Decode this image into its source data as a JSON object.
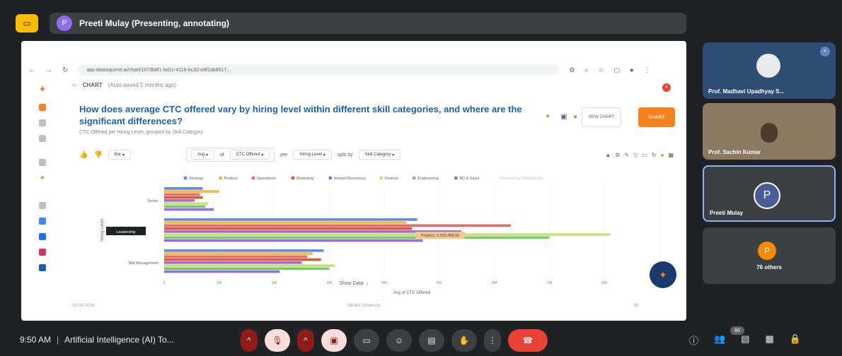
{
  "meet": {
    "presenter_label": "Preeti Mulay (Presenting, annotating)",
    "presenter_initial": "P",
    "time": "9:50 AM",
    "separator": "|",
    "meeting_title": "Artificial Intelligence (AI) To...",
    "participant_count": "80"
  },
  "browser": {
    "url": "app.datasquirrel.ai/chart/1073b8f1-bd1c-4116-bc32-e8f1ab8517..."
  },
  "app": {
    "breadcrumb_type": "CHART",
    "breadcrumb_saved": "(Auto-saved 5 months ago)",
    "question": "How does average CTC offered vary by hiring level within different skill categories, and where are the significant differences?",
    "subtitle": "CTC Offered per Hiring Level, grouped by Skill Category",
    "new_chart_label": "NEW CHART",
    "share_label": "SHARE",
    "notification_count": "4",
    "chart_type_select": "Bar",
    "agg_select": "Avg",
    "of_label": "of",
    "measure_select": "CTC Offered",
    "per_label": "per",
    "dimension_select": "Hiring Level",
    "split_label": "split by",
    "split_select": "Skill Category",
    "show_data": "Show Data",
    "footer_date": "03-04-2026",
    "footer_org": "Vikrant University",
    "footer_page": "98",
    "powered": "Powered by DataSquirrel"
  },
  "chart_data": {
    "type": "bar",
    "orientation": "horizontal",
    "categories": [
      "Senior",
      "Leadership",
      "Mid Management"
    ],
    "xlabel": "Avg of CTC Offered",
    "ylabel": "Hiring Level",
    "xlim": [
      0,
      9000000
    ],
    "xticks": [
      "0",
      "1M",
      "2M",
      "3M",
      "4M",
      "5M",
      "6M",
      "7M",
      "8M",
      "9M"
    ],
    "tooltip": "Product: 2,320,458.00",
    "series": [
      {
        "name": "Strategy",
        "color": "#5b8def",
        "values": [
          700000,
          4600000,
          2900000
        ]
      },
      {
        "name": "Product",
        "color": "#f4b942",
        "values": [
          1000000,
          4400000,
          2700000
        ]
      },
      {
        "name": "Operations",
        "color": "#e36b6b",
        "values": [
          650000,
          6300000,
          2600000
        ]
      },
      {
        "name": "Marketing",
        "color": "#d65a3c",
        "values": [
          700000,
          4500000,
          2850000
        ]
      },
      {
        "name": "Human Resources",
        "color": "#a66bd6",
        "values": [
          550000,
          5400000,
          2500000
        ]
      },
      {
        "name": "Finance",
        "color": "#c8e27a",
        "values": [
          800000,
          8100000,
          3100000
        ]
      },
      {
        "name": "Engineering",
        "color": "#7bc96f",
        "values": [
          750000,
          7000000,
          3000000
        ]
      },
      {
        "name": "BD & Sales",
        "color": "#9b6fd9",
        "values": [
          900000,
          4700000,
          2100000
        ]
      }
    ]
  }
}
